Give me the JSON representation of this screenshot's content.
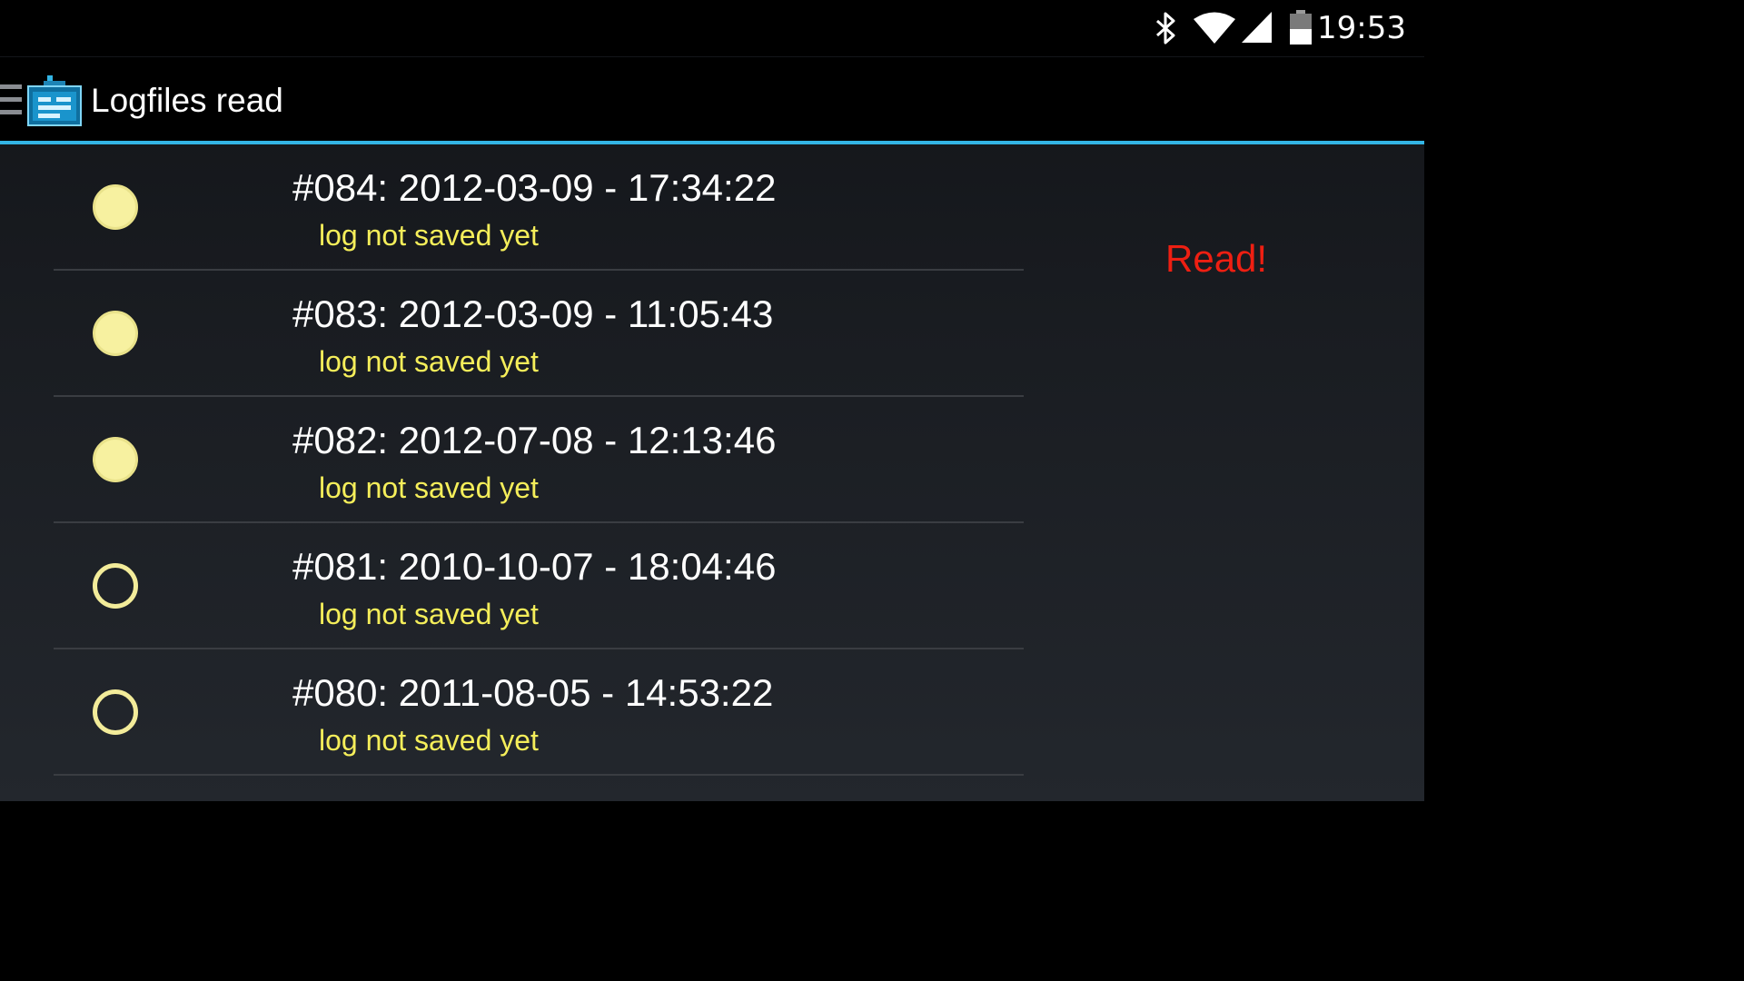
{
  "status_bar": {
    "time": "19:53",
    "icons": [
      "bluetooth-icon",
      "wifi-icon",
      "cell-signal-icon",
      "battery-icon"
    ]
  },
  "action_bar": {
    "title": "Logfiles read",
    "icons": [
      "drawer-menu-icon",
      "app-logo-icon"
    ]
  },
  "log_entries": [
    {
      "title": "#084: 2012-03-09 - 17:34:22",
      "subtitle": "log not saved yet",
      "indicator": "filled"
    },
    {
      "title": "#083: 2012-03-09 - 11:05:43",
      "subtitle": "log not saved yet",
      "indicator": "filled"
    },
    {
      "title": "#082: 2012-07-08 - 12:13:46",
      "subtitle": "log not saved yet",
      "indicator": "filled"
    },
    {
      "title": "#081: 2010-10-07 - 18:04:46",
      "subtitle": "log not saved yet",
      "indicator": "hollow"
    },
    {
      "title": "#080: 2011-08-05 - 14:53:22",
      "subtitle": "log not saved yet",
      "indicator": "hollow"
    }
  ],
  "read_button": {
    "label": "Read!"
  },
  "colors": {
    "accent": "#33b5e5",
    "title_text": "#ffffff",
    "subtitle_text": "#f5ee5a",
    "indicator": "#f7f1a0",
    "read_button": "#ee1f12"
  }
}
